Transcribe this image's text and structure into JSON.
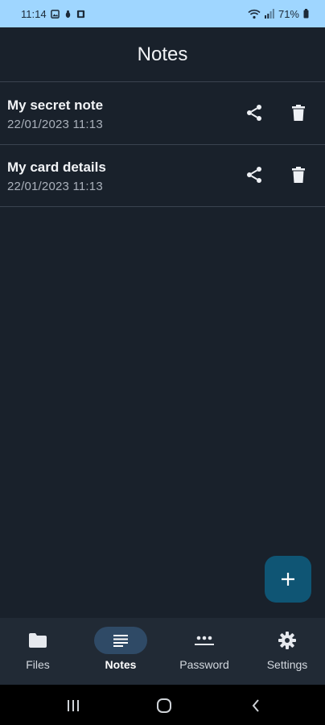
{
  "status_bar": {
    "time": "11:14",
    "battery": "71%"
  },
  "app_bar": {
    "title": "Notes"
  },
  "notes": [
    {
      "title": "My secret note",
      "date": "22/01/2023 11:13"
    },
    {
      "title": "My card details",
      "date": "22/01/2023 11:13"
    }
  ],
  "fab": {
    "icon": "plus-icon"
  },
  "bottom_nav": {
    "items": [
      {
        "label": "Files",
        "icon": "folder-icon",
        "active": false
      },
      {
        "label": "Notes",
        "icon": "notes-icon",
        "active": true
      },
      {
        "label": "Password",
        "icon": "password-icon",
        "active": false
      },
      {
        "label": "Settings",
        "icon": "gear-icon",
        "active": false
      }
    ]
  },
  "colors": {
    "background": "#19212b",
    "status_bar": "#9fd6ff",
    "fab": "#0f5574",
    "nav_active_pill": "#2f4a66"
  }
}
